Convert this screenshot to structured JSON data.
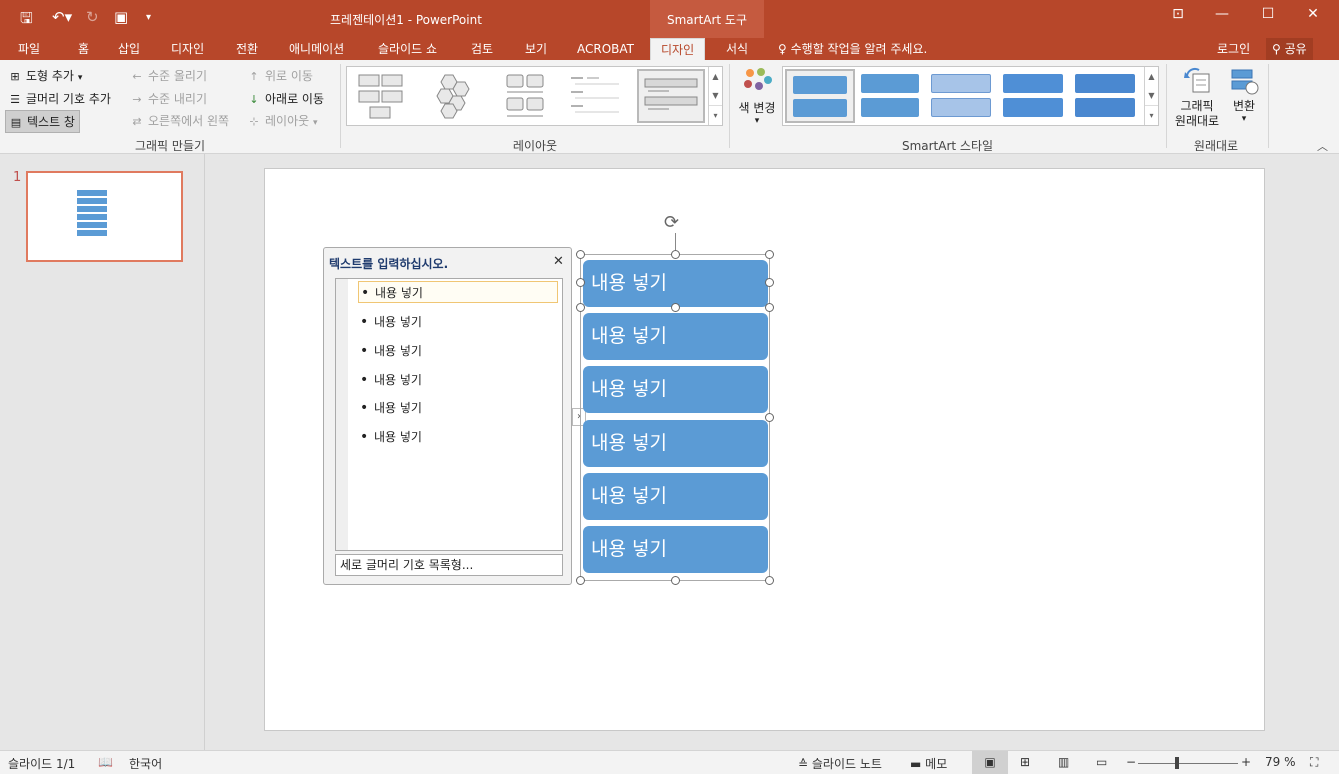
{
  "titlebar": {
    "doc_title": "프레젠테이션1 - PowerPoint",
    "contextual_title": "SmartArt 도구"
  },
  "tabs": [
    "파일",
    "홈",
    "삽입",
    "디자인",
    "전환",
    "애니메이션",
    "슬라이드 쇼",
    "검토",
    "보기",
    "ACROBAT",
    "디자인",
    "서식"
  ],
  "active_tab_index": 10,
  "tellme": "수행할 작업을 알려 주세요.",
  "login": "로그인",
  "share": "공유",
  "ribbon": {
    "create_graphic": {
      "add_shape": "도형 추가",
      "add_bullet": "글머리 기호 추가",
      "text_pane": "텍스트 창",
      "promote": "수준 올리기",
      "demote": "수준 내리기",
      "right_to_left": "오른쪽에서 왼쪽",
      "move_up": "위로 이동",
      "move_down": "아래로 이동",
      "layout": "레이아웃",
      "label": "그래픽 만들기"
    },
    "layouts": {
      "label": "레이아웃"
    },
    "smartart_styles": {
      "change_colors": "색 변경",
      "label": "SmartArt 스타일"
    },
    "reset": {
      "reset_graphic_1": "그래픽",
      "reset_graphic_2": "원래대로",
      "convert": "변환",
      "label": "원래대로"
    }
  },
  "slide_number": "1",
  "text_pane": {
    "title": "텍스트를 입력하십시오.",
    "items": [
      "내용 넣기",
      "내용 넣기",
      "내용 넣기",
      "내용 넣기",
      "내용 넣기",
      "내용 넣기"
    ],
    "footer": "세로 글머리 기호 목록형..."
  },
  "smartart_boxes": [
    "내용 넣기",
    "내용 넣기",
    "내용 넣기",
    "내용 넣기",
    "내용 넣기",
    "내용 넣기"
  ],
  "statusbar": {
    "slide_info": "슬라이드 1/1",
    "language": "한국어",
    "notes": "슬라이드 노트",
    "comments": "메모",
    "zoom": "79 %"
  },
  "colors": {
    "accent": "#b7472a",
    "smartart_fill": "#5b9bd5"
  }
}
